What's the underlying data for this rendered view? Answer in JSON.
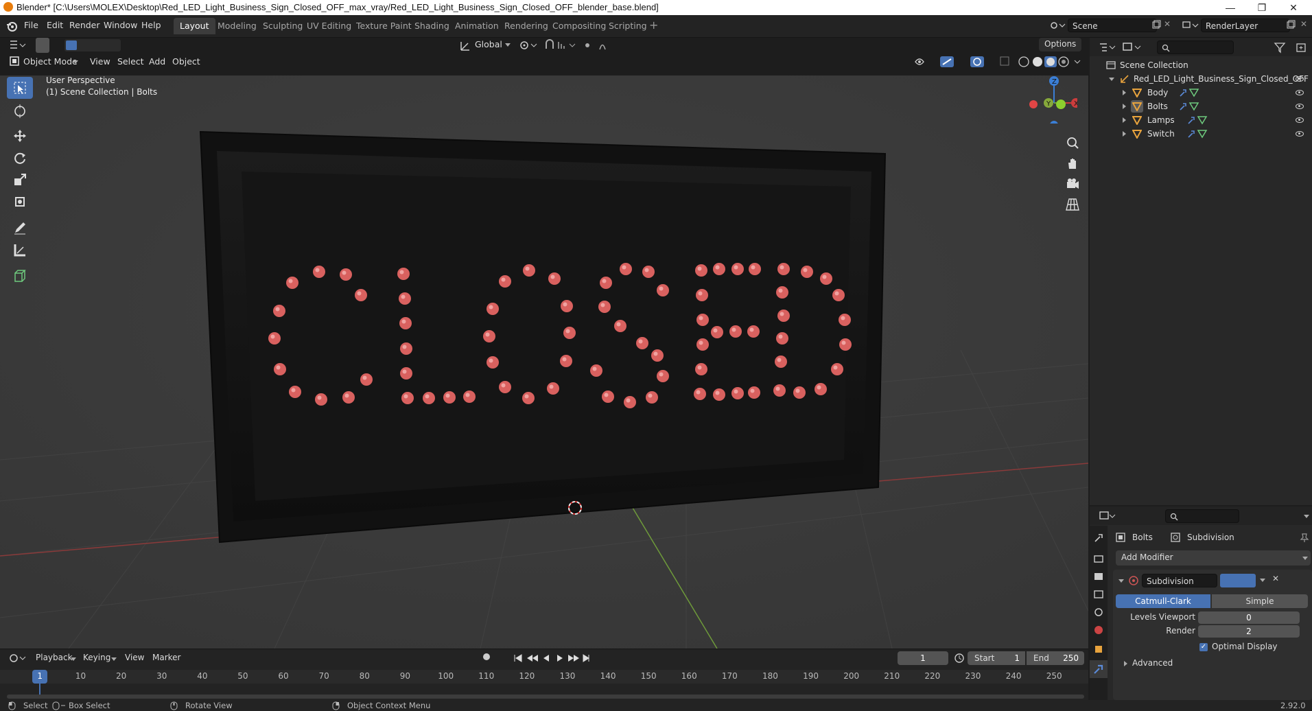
{
  "window": {
    "title": "Blender* [C:\\Users\\MOLEX\\Desktop\\Red_LED_Light_Business_Sign_Closed_OFF_max_vray/Red_LED_Light_Business_Sign_Closed_OFF_blender_base.blend]",
    "minimize": "—",
    "maximize": "❐",
    "close": "✕"
  },
  "menu": {
    "file": "File",
    "edit": "Edit",
    "render": "Render",
    "window": "Window",
    "help": "Help"
  },
  "workspaces": [
    "Layout",
    "Modeling",
    "Sculpting",
    "UV Editing",
    "Texture Paint",
    "Shading",
    "Animation",
    "Rendering",
    "Compositing",
    "Scripting"
  ],
  "scene": {
    "name": "Scene",
    "view_layer": "RenderLayer"
  },
  "viewport_header": {
    "transform_orientation": "Global",
    "options": "Options",
    "mode": "Object Mode",
    "view": "View",
    "select": "Select",
    "add": "Add",
    "object": "Object"
  },
  "viewport": {
    "perspective_label": "User Perspective",
    "collection_label": "(1) Scene Collection | Bolts",
    "gizmo": {
      "x": "X",
      "y": "Y",
      "z": "Z"
    },
    "led_color": "#d9615f",
    "sign_color": "#151515"
  },
  "outliner": {
    "root": "Scene Collection",
    "collection": "Red_LED_Light_Business_Sign_Closed_OFF",
    "objects": [
      "Body",
      "Bolts",
      "Lamps",
      "Switch"
    ]
  },
  "properties": {
    "object_name": "Bolts",
    "modifier_crumb": "Subdivision",
    "add_modifier": "Add Modifier",
    "modifier_name": "Subdivision",
    "catmull_clark": "Catmull-Clark",
    "simple": "Simple",
    "levels_viewport_label": "Levels Viewport",
    "levels_viewport_value": "0",
    "render_label": "Render",
    "render_value": "2",
    "optimal_display": "Optimal Display",
    "advanced": "Advanced",
    "accent": "#4772b3"
  },
  "timeline": {
    "playback": "Playback",
    "keying": "Keying",
    "view": "View",
    "marker": "Marker",
    "current_frame": "1",
    "start_label": "Start",
    "start": "1",
    "end_label": "End",
    "end": "250",
    "ticks": [
      "1",
      "10",
      "20",
      "30",
      "40",
      "50",
      "60",
      "70",
      "80",
      "90",
      "100",
      "110",
      "120",
      "130",
      "140",
      "150",
      "160",
      "170",
      "180",
      "190",
      "200",
      "210",
      "220",
      "230",
      "240",
      "250"
    ]
  },
  "statusbar": {
    "select": "Select",
    "box_select": "Box Select",
    "rotate_view": "Rotate View",
    "context_menu": "Object Context Menu",
    "version": "2.92.0"
  }
}
